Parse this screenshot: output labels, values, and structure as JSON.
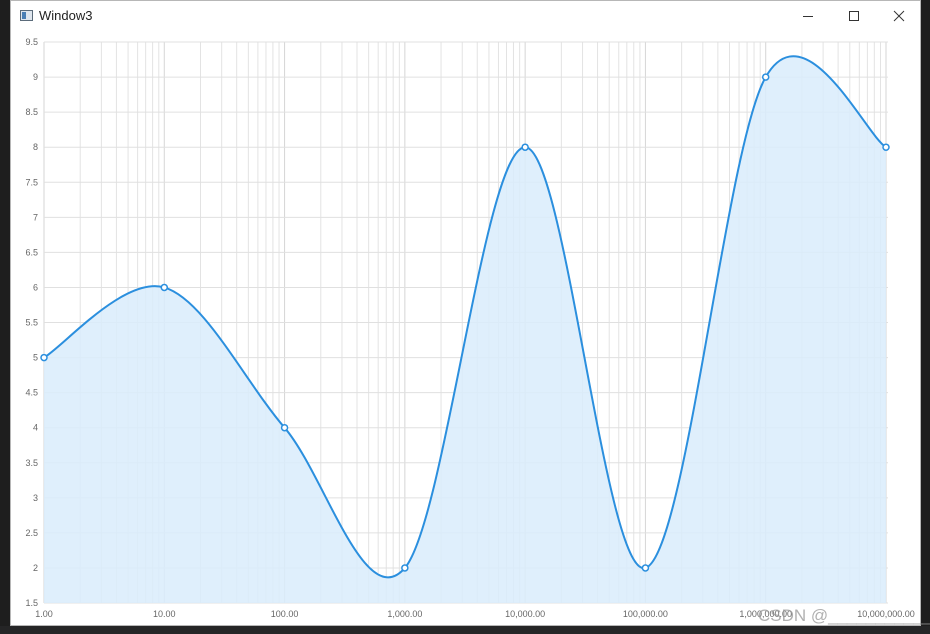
{
  "window": {
    "title": "Window3",
    "icon": "app-window-icon",
    "controls": [
      "minimize-icon",
      "maximize-icon",
      "close-icon"
    ]
  },
  "chart_data": {
    "type": "area",
    "x_scale": "log",
    "x": [
      1,
      10,
      100,
      1000,
      10000,
      100000,
      1000000,
      10000000
    ],
    "y": [
      5,
      6,
      4,
      2,
      8,
      2,
      9,
      8
    ],
    "xlim": [
      1,
      10000000
    ],
    "ylim": [
      1.5,
      9.5
    ],
    "x_tick_labels": [
      "1.00",
      "10.00",
      "100.00",
      "1,000.00",
      "10,000.00",
      "100,000.00",
      "1,000,000.00",
      "10,000,000.00"
    ],
    "y_tick_labels": [
      "1.5",
      "2",
      "2.5",
      "3",
      "3.5",
      "4",
      "4.5",
      "5",
      "5.5",
      "6",
      "6.5",
      "7",
      "7.5",
      "8",
      "8.5",
      "9",
      "9.5"
    ],
    "grid": true,
    "line_color": "#2b8fde",
    "fill_color": "#d9ecfb",
    "smooth": true
  },
  "watermark": {
    "text": "CSDN @____________"
  }
}
